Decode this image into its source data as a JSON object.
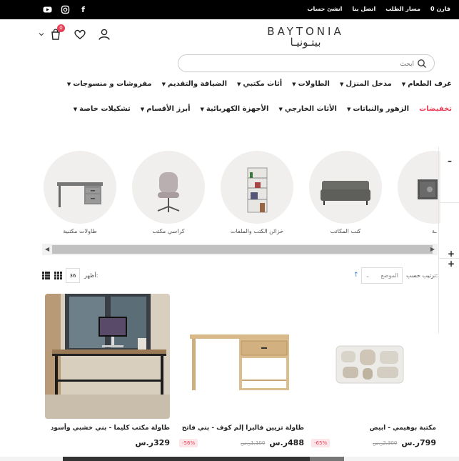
{
  "topbar": {
    "links": [
      "قارن 0",
      "مسار الطلب",
      "اتصل بنا",
      "انشئ حساب"
    ],
    "social_icons": [
      "youtube-icon",
      "instagram-icon",
      "facebook-icon"
    ]
  },
  "header": {
    "logo_en": "BAYTONIA",
    "logo_ar": "بيتـونيـا",
    "cart_count": "0"
  },
  "search": {
    "placeholder": "ابحث"
  },
  "nav": {
    "row1": [
      "غرف الطعام",
      "مدخل المنزل",
      "الطاولات",
      "أثاث مكتبي",
      "الضيافة والتقديم",
      "مفروشات و منسوجات"
    ],
    "row2": [
      "تخفيضات",
      "الزهور والنباتات",
      "الأثاث الخارجي",
      "الأجهزة الكهربائية",
      "أبرز الأقسام",
      "تشكيلات خاصة"
    ]
  },
  "categories": [
    {
      "label": "طاولات مكتبية"
    },
    {
      "label": "كراسي مكتب"
    },
    {
      "label": "خزائن الكتب والملفات"
    },
    {
      "label": "كنب المكاتب"
    },
    {
      "label": "ـة"
    }
  ],
  "toolbar": {
    "show_label": "أظهر:",
    "show_value": "36",
    "sort_label": "ترتيب حسب:",
    "sort_value": "الموضع"
  },
  "products": [
    {
      "name": "طاولة مكتب كليما - بني خشبي وأسود",
      "price": "329ر.س",
      "old_price": "",
      "discount": ""
    },
    {
      "name": "طاولة تزيين فاليرا إلم كوف - بني فاتح",
      "price": "488ر.س",
      "old_price": "1,100ر.س",
      "discount": "56%-"
    },
    {
      "name": "مكتبة بوهيمي - ابيض",
      "price": "799ر.س",
      "old_price": "2,300ر.س",
      "discount": "65%-"
    }
  ],
  "colors": {
    "accent": "#e94157",
    "topbar": "#000000"
  }
}
